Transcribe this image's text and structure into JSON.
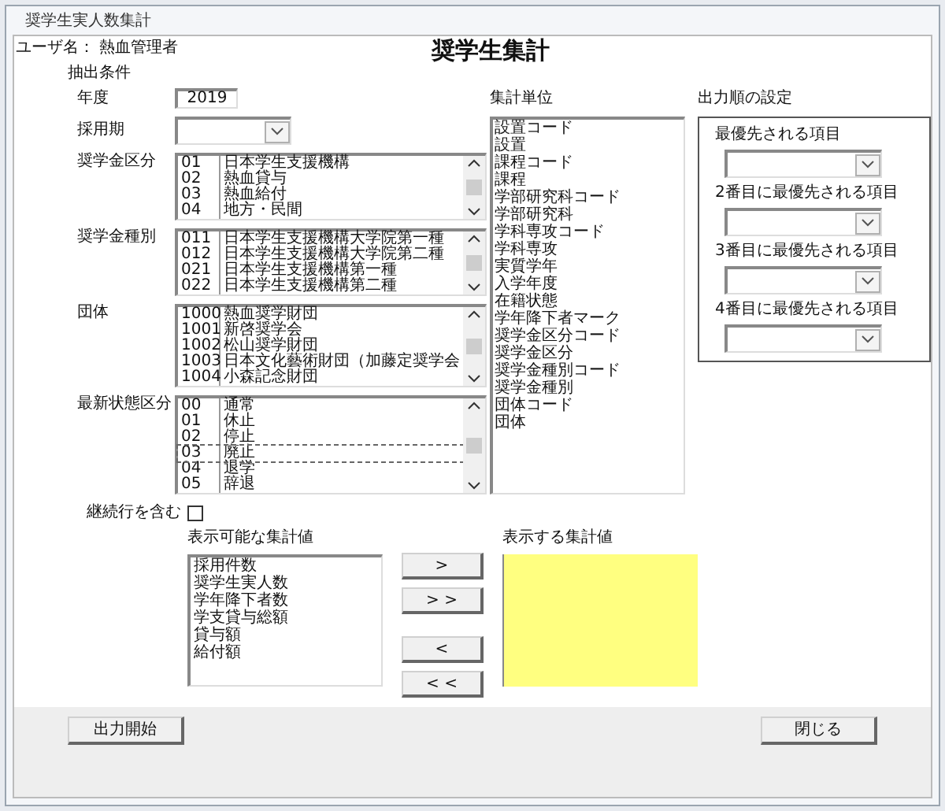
{
  "window": {
    "title": "奨学生実人数集計"
  },
  "user": "ユーザ名： 熱血管理者",
  "heading": "奨学生集計",
  "filter": {
    "title": "抽出条件",
    "year": {
      "label": "年度",
      "value": "2019"
    },
    "period": {
      "label": "採用期"
    },
    "lists": [
      {
        "label": "奨学金区分",
        "items": [
          {
            "code": "01",
            "name": "日本学生支援機構",
            "focused": false
          },
          {
            "code": "02",
            "name": "熱血貸与",
            "focused": false
          },
          {
            "code": "03",
            "name": "熱血給付",
            "focused": false
          },
          {
            "code": "04",
            "name": "地方・民間",
            "focused": false
          }
        ]
      },
      {
        "label": "奨学金種別",
        "items": [
          {
            "code": "011",
            "name": "日本学生支援機構大学院第一種",
            "focused": false
          },
          {
            "code": "012",
            "name": "日本学生支援機構大学院第二種",
            "focused": false
          },
          {
            "code": "021",
            "name": "日本学生支援機構第一種",
            "focused": false
          },
          {
            "code": "022",
            "name": "日本学生支援機構第二種",
            "focused": false
          }
        ]
      },
      {
        "label": "団体",
        "items": [
          {
            "code": "1000",
            "name": "熱血奨学財団",
            "focused": false
          },
          {
            "code": "1001",
            "name": "新啓奨学会",
            "focused": false
          },
          {
            "code": "1002",
            "name": "松山奨学財団",
            "focused": false
          },
          {
            "code": "1003",
            "name": "日本文化藝術財団（加藤定奨学会",
            "focused": false
          },
          {
            "code": "1004",
            "name": "小森記念財団",
            "focused": false
          }
        ]
      },
      {
        "label": "最新状態区分",
        "items": [
          {
            "code": "00",
            "name": "通常",
            "focused": false
          },
          {
            "code": "01",
            "name": "休止",
            "focused": false
          },
          {
            "code": "02",
            "name": "停止",
            "focused": false
          },
          {
            "code": "03",
            "name": "廃止",
            "focused": true
          },
          {
            "code": "04",
            "name": "退学",
            "focused": false
          },
          {
            "code": "05",
            "name": "辞退",
            "focused": false
          }
        ]
      }
    ],
    "continuation": {
      "label": "継続行を含む",
      "checked": false
    }
  },
  "units": {
    "title": "集計単位",
    "items": [
      "設置コード",
      "設置",
      "課程コード",
      "課程",
      "学部研究科コード",
      "学部研究科",
      "学科専攻コード",
      "学科専攻",
      "実質学年",
      "入学年度",
      "在籍状態",
      "学年降下者マーク",
      "奨学金区分コード",
      "奨学金区分",
      "奨学金種別コード",
      "奨学金種別",
      "団体コード",
      "団体"
    ]
  },
  "order": {
    "title": "出力順の設定",
    "fields": [
      {
        "label": "最優先される項目"
      },
      {
        "label": "2番目に最優先される項目"
      },
      {
        "label": "3番目に最優先される項目"
      },
      {
        "label": "4番目に最優先される項目"
      }
    ]
  },
  "available": {
    "title": "表示可能な集計値",
    "items": [
      "採用件数",
      "奨学生実人数",
      "学年降下者数",
      "学支貸与総額",
      "貸与額",
      "給付額"
    ]
  },
  "move_buttons": [
    ">",
    "> >",
    "<",
    "< <"
  ],
  "selected_values": {
    "title": "表示する集計値"
  },
  "buttons": [
    "出力開始",
    "閉じる"
  ]
}
